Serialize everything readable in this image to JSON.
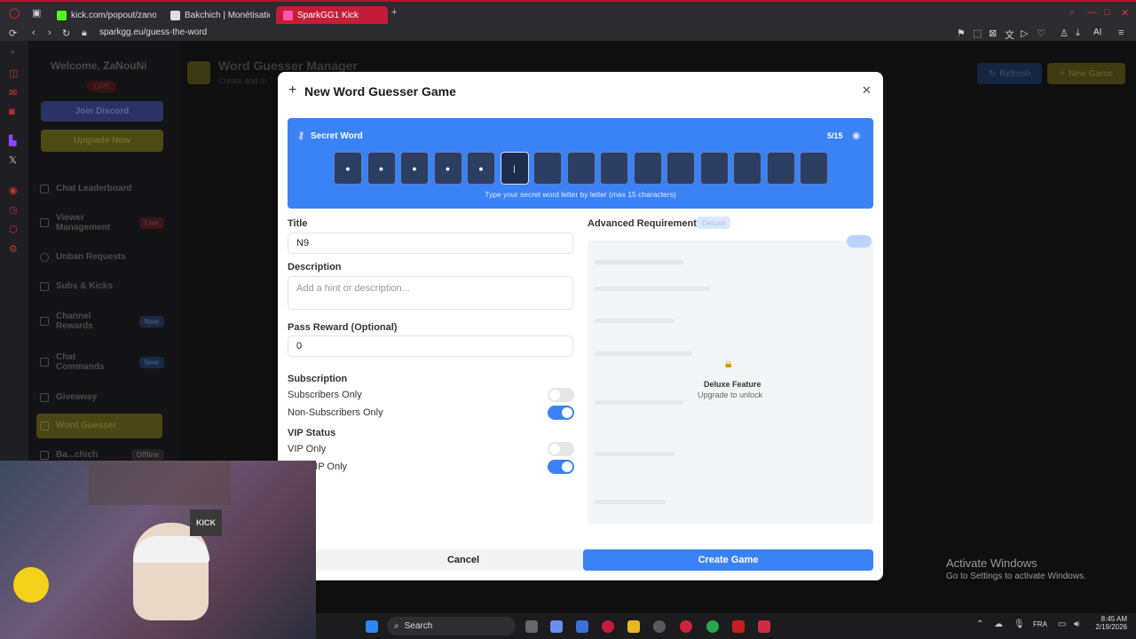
{
  "browser": {
    "tabs": [
      {
        "title": "kick.com/popout/zanouni/",
        "active": false
      },
      {
        "title": "Bakchich | Monétisation p",
        "active": false
      },
      {
        "title": "SparkGG1 Kick",
        "active": true
      }
    ],
    "address": "sparkgg.eu/guess-the-word",
    "extension_label": "AI"
  },
  "sidebar": {
    "welcome": "Welcome,",
    "username": "ZaNouNi",
    "live_badge": "LIVE",
    "join_discord": "Join Discord",
    "upgrade_now": "Upgrade Now",
    "items": [
      {
        "label": "Chat Leaderboard",
        "badge": ""
      },
      {
        "label": "Viewer Management",
        "badge": "Live"
      },
      {
        "label": "Unban Requests",
        "badge": ""
      },
      {
        "label": "Subs & Kicks",
        "badge": ""
      },
      {
        "label": "Channel Rewards",
        "badge": "New"
      },
      {
        "label": "Chat Commands",
        "badge": "New"
      },
      {
        "label": "Giveaway",
        "badge": ""
      },
      {
        "label": "Word Guesser",
        "badge": ""
      },
      {
        "label": "Ba...chich",
        "badge": "Offline"
      }
    ]
  },
  "page": {
    "title": "Word Guesser Manager",
    "subtitle": "Create and m",
    "refresh": "Refresh",
    "new_game": "New Game"
  },
  "modal": {
    "title": "New Word Guesser Game",
    "secret_word": {
      "label": "Secret Word",
      "counter": "5/15",
      "filled": 5,
      "max": 15,
      "hint": "Type your secret word letter by letter (max 15 characters)"
    },
    "title_label": "Title",
    "title_value": "N9",
    "description_label": "Description",
    "description_placeholder": "Add a hint or description...",
    "reward_label": "Pass Reward (Optional)",
    "reward_value": "0",
    "subscription_label": "Subscription",
    "subscribers_only": "Subscribers Only",
    "subscribers_only_on": false,
    "non_subscribers_only": "Non-Subscribers Only",
    "non_subscribers_only_on": true,
    "vip_label": "VIP Status",
    "vip_only": "VIP Only",
    "vip_only_on": false,
    "non_vip_only": "Non-VIP Only",
    "non_vip_only_on": true,
    "advanced_label": "Advanced Requirements",
    "deluxe_badge": "Deluxe",
    "deluxe_feature": "Deluxe Feature",
    "upgrade_unlock": "Upgrade to unlock",
    "cancel": "Cancel",
    "create": "Create Game"
  },
  "windows": {
    "activate_title": "Activate Windows",
    "activate_sub": "Go to Settings to activate Windows.",
    "search": "Search",
    "lang": "FRA",
    "time": "8:45 AM",
    "date": "2/19/2026"
  },
  "colors": {
    "accent": "#3b82f6",
    "opera_red": "#c31d3a"
  }
}
